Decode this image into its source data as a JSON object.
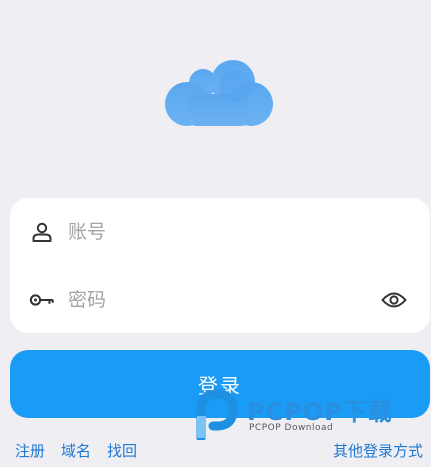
{
  "logo": {
    "icon": "cloud-icon",
    "color": "#5aa7f0"
  },
  "form": {
    "account": {
      "icon": "user-icon",
      "placeholder": "账号",
      "value": ""
    },
    "password": {
      "icon": "key-icon",
      "placeholder": "密码",
      "value": "",
      "toggle_icon": "eye-icon"
    }
  },
  "login_button": {
    "label": "登录",
    "color": "#1a9bf5"
  },
  "links": {
    "register": "注册",
    "domain": "域名",
    "find_back": "找回",
    "other_login": "其他登录方式"
  },
  "watermark": {
    "title": "PCPOP下载",
    "subtitle": "PCPOP Download"
  }
}
